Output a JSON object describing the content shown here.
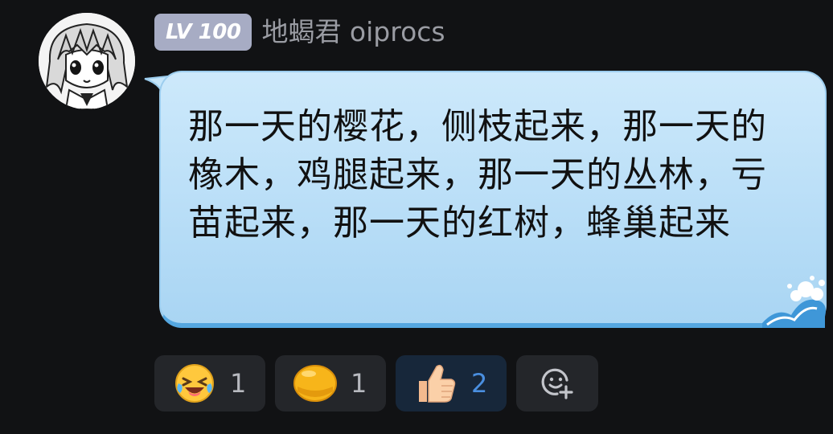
{
  "user": {
    "level": "LV 100",
    "name": "地蝎君 oiprocs",
    "avatar_icon": "anime-avatar-icon"
  },
  "message": {
    "text": "那一天的樱花，侧枝起来，那一天的橡木，鸡腿起来，那一天的丛林，亏苗起来，那一天的红树，蜂巢起来"
  },
  "reactions": [
    {
      "icon": "laugh-cry-icon",
      "count": "1",
      "active": false
    },
    {
      "icon": "bald-head-icon",
      "count": "1",
      "active": false
    },
    {
      "icon": "thumbs-up-icon",
      "count": "2",
      "active": true
    }
  ],
  "add_reaction": {
    "icon": "add-reaction-icon"
  },
  "colors": {
    "background": "#111214",
    "bubble": "#b9def7",
    "bubble_border": "#55a7e0",
    "badge": "#a7acc4",
    "active_count": "#4a8fe0"
  }
}
